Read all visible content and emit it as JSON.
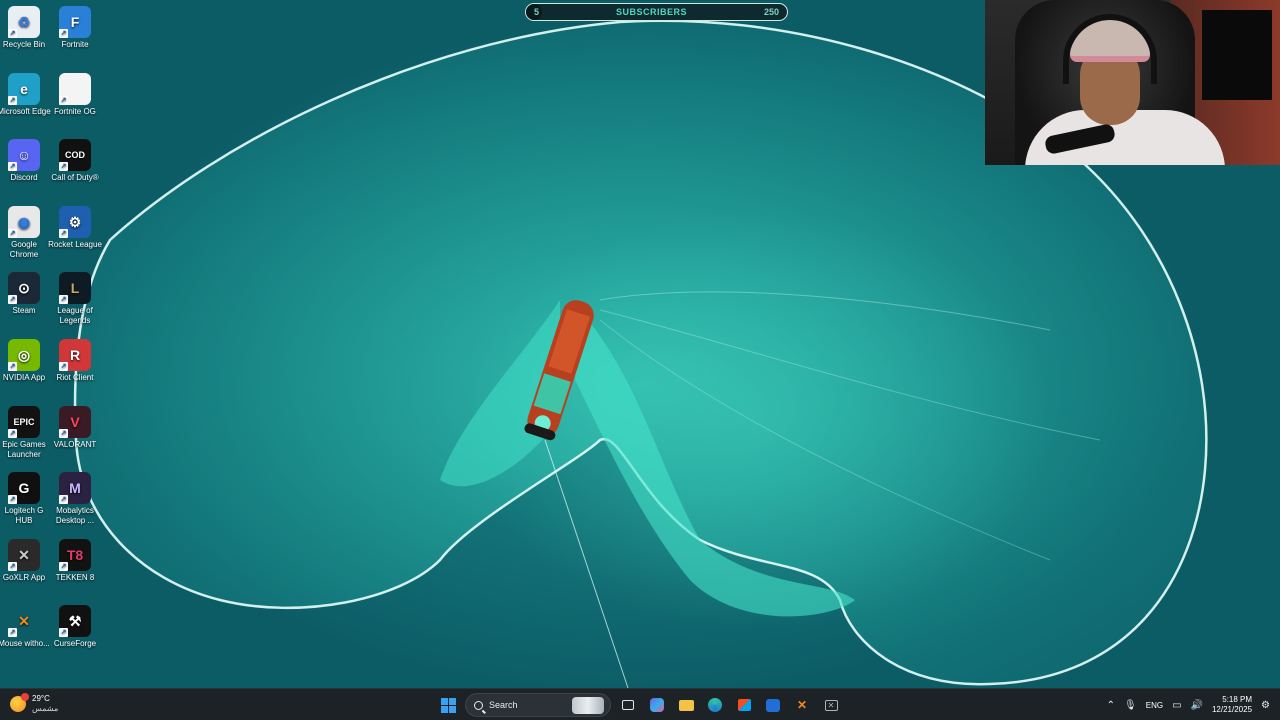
{
  "subscriber_goal": {
    "title": "SUBSCRIBERS",
    "start": "5",
    "goal": "250",
    "progress": 0.02
  },
  "desktop_icons": [
    {
      "label": "Recycle Bin",
      "icon": "recycle-bin-icon",
      "color": "#e9eef2",
      "glyph": "♻",
      "fg": "#3a7bd5"
    },
    {
      "label": "Fortnite",
      "icon": "fortnite-icon",
      "color": "#2a7fd6",
      "glyph": "F",
      "fg": "#ffffff"
    },
    {
      "label": "Microsoft Edge",
      "icon": "edge-icon",
      "color": "#1fa0c8",
      "glyph": "e",
      "fg": "#ffffff"
    },
    {
      "label": "Fortnite OG",
      "icon": "file-icon",
      "color": "#f4f4f4",
      "glyph": "",
      "fg": "#333"
    },
    {
      "label": "Discord",
      "icon": "discord-icon",
      "color": "#5865f2",
      "glyph": "☺",
      "fg": "#ffffff"
    },
    {
      "label": "Call of Duty®",
      "icon": "call-of-duty-icon",
      "color": "#111111",
      "glyph": "COD",
      "fg": "#ffffff"
    },
    {
      "label": "Google Chrome",
      "icon": "chrome-icon",
      "color": "#e8e8e8",
      "glyph": "◉",
      "fg": "#2f7de1"
    },
    {
      "label": "Rocket League",
      "icon": "rocket-league-icon",
      "color": "#1f5fb0",
      "glyph": "⚙",
      "fg": "#ffffff"
    },
    {
      "label": "Steam",
      "icon": "steam-icon",
      "color": "#1b2838",
      "glyph": "⊙",
      "fg": "#ffffff"
    },
    {
      "label": "League of Legends",
      "icon": "league-of-legends-icon",
      "color": "#0e1a24",
      "glyph": "L",
      "fg": "#c9aa5a"
    },
    {
      "label": "NVIDIA App",
      "icon": "nvidia-icon",
      "color": "#76b900",
      "glyph": "◎",
      "fg": "#ffffff"
    },
    {
      "label": "Riot Client",
      "icon": "riot-client-icon",
      "color": "#d13639",
      "glyph": "R",
      "fg": "#ffffff"
    },
    {
      "label": "Epic Games Launcher",
      "icon": "epic-games-icon",
      "color": "#121212",
      "glyph": "EPIC",
      "fg": "#ffffff"
    },
    {
      "label": "VALORANT",
      "icon": "valorant-icon",
      "color": "#3a1a24",
      "glyph": "V",
      "fg": "#ff4655"
    },
    {
      "label": "Logitech G HUB",
      "icon": "logitech-icon",
      "color": "#101010",
      "glyph": "G",
      "fg": "#ffffff"
    },
    {
      "label": "Mobalytics Desktop ...",
      "icon": "mobalytics-icon",
      "color": "#2b2140",
      "glyph": "M",
      "fg": "#c8b8ff"
    },
    {
      "label": "GoXLR App",
      "icon": "goxlr-icon",
      "color": "#2a2a2a",
      "glyph": "✕",
      "fg": "#cccccc"
    },
    {
      "label": "TEKKEN 8",
      "icon": "tekken-icon",
      "color": "#121212",
      "glyph": "T8",
      "fg": "#e43a6a"
    },
    {
      "label": "Mouse witho...",
      "icon": "mouse-without-borders-icon",
      "color": "#00000000",
      "glyph": "✕",
      "fg": "#f08a1c"
    },
    {
      "label": "CurseForge",
      "icon": "curseforge-icon",
      "color": "#111111",
      "glyph": "⚒",
      "fg": "#ffffff"
    }
  ],
  "taskbar": {
    "weather": {
      "temp": "29°C",
      "condition": "مشمس"
    },
    "search_placeholder": "Search",
    "language": "ENG",
    "time": "5:18 PM",
    "date": "12/21/2025"
  }
}
